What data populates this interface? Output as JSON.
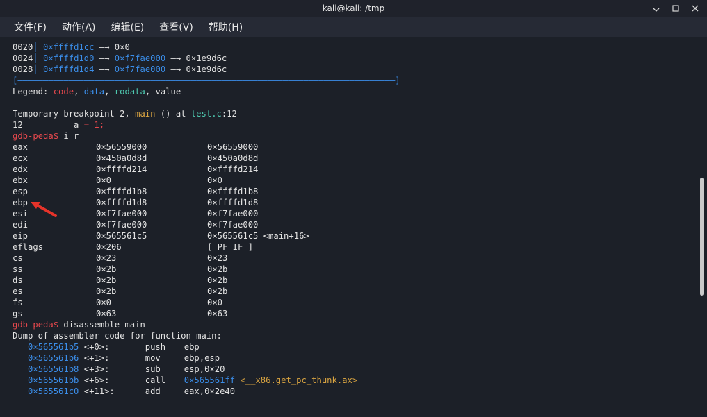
{
  "window": {
    "title": "kali@kali: /tmp",
    "controls": [
      "minimize-icon",
      "maximize-icon",
      "close-icon"
    ]
  },
  "menu": [
    "文件(F)",
    "动作(A)",
    "编辑(E)",
    "查看(V)",
    "帮助(H)"
  ],
  "stack": [
    {
      "off": "0020",
      "addr": "0×ffffd1cc",
      "arrow": "—→",
      "v1": "0×0",
      "v2": ""
    },
    {
      "off": "0024",
      "addr": "0×ffffd1d0",
      "arrow": "—→",
      "v1": "0×f7fae000",
      "v2": "0×1e9d6c"
    },
    {
      "off": "0028",
      "addr": "0×ffffd1d4",
      "arrow": "—→",
      "v1": "0×f7fae000",
      "v2": "0×1e9d6c"
    }
  ],
  "divider": "[——————————————————————————————————————————————————————————————————————————]",
  "legend": {
    "prefix": "Legend: ",
    "code": "code",
    "data": "data",
    "rodata": "rodata",
    "value": "value"
  },
  "bp": {
    "pre": "Temporary breakpoint 2, ",
    "fn": "main",
    "mid": " () at ",
    "file": "test.c",
    "post": ":12"
  },
  "src": {
    "num": "12",
    "code1": "          a ",
    "op": "=",
    "code2": " 1;"
  },
  "prompt1": {
    "prompt": "gdb-peda$",
    "cmd": " i r"
  },
  "regs": [
    {
      "n": "eax",
      "a": "0×56559000",
      "b": "0×56559000",
      "c": ""
    },
    {
      "n": "ecx",
      "a": "0×450a0d8d",
      "b": "0×450a0d8d",
      "c": ""
    },
    {
      "n": "edx",
      "a": "0×ffffd214",
      "b": "0×ffffd214",
      "c": ""
    },
    {
      "n": "ebx",
      "a": "0×0",
      "b": "0×0",
      "c": ""
    },
    {
      "n": "esp",
      "a": "0×ffffd1b8",
      "b": "0×ffffd1b8",
      "c": ""
    },
    {
      "n": "ebp",
      "a": "0×ffffd1d8",
      "b": "0×ffffd1d8",
      "c": ""
    },
    {
      "n": "esi",
      "a": "0×f7fae000",
      "b": "0×f7fae000",
      "c": ""
    },
    {
      "n": "edi",
      "a": "0×f7fae000",
      "b": "0×f7fae000",
      "c": ""
    },
    {
      "n": "eip",
      "a": "0×565561c5",
      "b": "0×565561c5",
      "c": " <main+16>"
    },
    {
      "n": "eflags",
      "a": "0×206",
      "b": "[ PF IF ]",
      "c": ""
    },
    {
      "n": "cs",
      "a": "0×23",
      "b": "0×23",
      "c": ""
    },
    {
      "n": "ss",
      "a": "0×2b",
      "b": "0×2b",
      "c": ""
    },
    {
      "n": "ds",
      "a": "0×2b",
      "b": "0×2b",
      "c": ""
    },
    {
      "n": "es",
      "a": "0×2b",
      "b": "0×2b",
      "c": ""
    },
    {
      "n": "fs",
      "a": "0×0",
      "b": "0×0",
      "c": ""
    },
    {
      "n": "gs",
      "a": "0×63",
      "b": "0×63",
      "c": ""
    }
  ],
  "prompt2": {
    "prompt": "gdb-peda$",
    "cmd": " disassemble main"
  },
  "dump": "Dump of assembler code for function main:",
  "asm": [
    {
      "addr": "0×565561b5",
      "off": "<+0>:",
      "op": "push",
      "args": "ebp",
      "extra1": "",
      "extra2": ""
    },
    {
      "addr": "0×565561b6",
      "off": "<+1>:",
      "op": "mov",
      "args": "ebp,esp",
      "extra1": "",
      "extra2": ""
    },
    {
      "addr": "0×565561b8",
      "off": "<+3>:",
      "op": "sub",
      "args": "esp,0×20",
      "extra1": "",
      "extra2": ""
    },
    {
      "addr": "0×565561bb",
      "off": "<+6>:",
      "op": "call",
      "args": "",
      "extra1": "0×565561ff",
      "extra2": " <__x86.get_pc_thunk.ax>"
    },
    {
      "addr": "0×565561c0",
      "off": "<+11>:",
      "op": "add",
      "args": "eax,0×2e40",
      "extra1": "",
      "extra2": ""
    }
  ]
}
